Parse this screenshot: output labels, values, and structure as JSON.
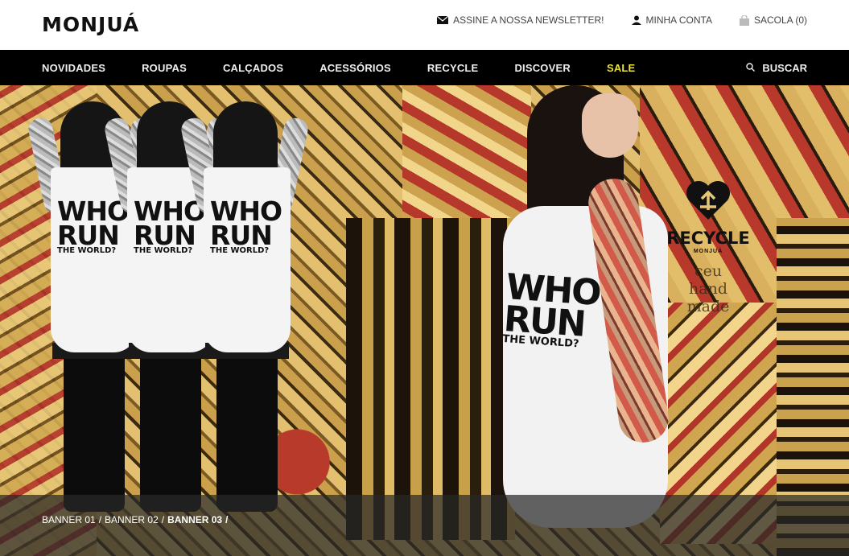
{
  "brand": {
    "logo": "MONJUÁ"
  },
  "toplinks": [
    {
      "icon": "envelope-icon",
      "label": "ASSINE A NOSSA NEWSLETTER!"
    },
    {
      "icon": "user-icon",
      "label": "MINHA CONTA"
    },
    {
      "icon": "bag-icon",
      "label": "SACOLA (0)"
    }
  ],
  "nav": {
    "items": [
      {
        "label": "NOVIDADES"
      },
      {
        "label": "ROUPAS"
      },
      {
        "label": "CALÇADOS"
      },
      {
        "label": "ACESSÓRIOS"
      },
      {
        "label": "RECYCLE"
      },
      {
        "label": "DISCOVER"
      },
      {
        "label": "SALE"
      }
    ],
    "search_label": "BUSCAR",
    "sale_color": "#e8e13a"
  },
  "hero": {
    "shirt_line1": "WHO",
    "shirt_line2": "RUN",
    "shirt_line3": "THE WORLD?",
    "recycle_title": "RECYCLE",
    "recycle_brand": "MONJUÁ",
    "handmade_line1": "ceu",
    "handmade_line2": "hand",
    "handmade_line3": "made"
  },
  "banners": {
    "items": [
      {
        "label": "BANNER 01"
      },
      {
        "label": "BANNER 02"
      },
      {
        "label": "BANNER 03"
      }
    ],
    "separator": "/",
    "active_index": 2
  }
}
